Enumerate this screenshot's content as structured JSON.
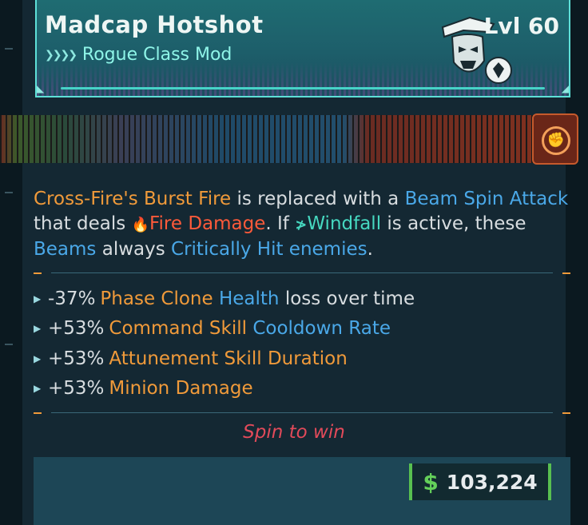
{
  "item": {
    "name": "Madcap Hotshot",
    "class_mod": "Rogue Class Mod",
    "level": "Lvl 60",
    "rarity_chevrons": "❯❯❯❯"
  },
  "description": {
    "p1": "Cross-Fire's Burst Fire",
    "p2": " is replaced with a ",
    "p3": "Beam Spin Attack",
    "p4": " that deals ",
    "p5": "🔥",
    "p6": "Fire Damage",
    "p7": ". If ",
    "p8": "Windfall",
    "p9": " is active, these ",
    "p10": "Beams",
    "p11": " always ",
    "p12": "Critically Hit enemies",
    "p13": "."
  },
  "stats": [
    {
      "value": "-37%",
      "a": "Phase Clone",
      "b": "Health",
      "c": "loss over time"
    },
    {
      "value": "+53%",
      "a": "Command Skill",
      "b": "Cooldown Rate",
      "c": ""
    },
    {
      "value": "+53%",
      "a": "Attunement Skill Duration",
      "b": "",
      "c": ""
    },
    {
      "value": "+53%",
      "a": "Minion Damage",
      "b": "",
      "c": ""
    }
  ],
  "flavor_text": "Spin to win",
  "price": {
    "currency_symbol": "$",
    "amount": "103,224"
  },
  "icons": [
    "rarity-chevrons-icon",
    "class-emblem-icon",
    "fire-icon",
    "windfall-icon",
    "class-tab-icon",
    "bullet-icon"
  ],
  "colors": {
    "accent_teal": "#46d8c0",
    "highlight_orange": "#f09a3a",
    "highlight_blue": "#4aa8e8",
    "flavor_red": "#e24a5a",
    "money_green": "#64d05a"
  }
}
